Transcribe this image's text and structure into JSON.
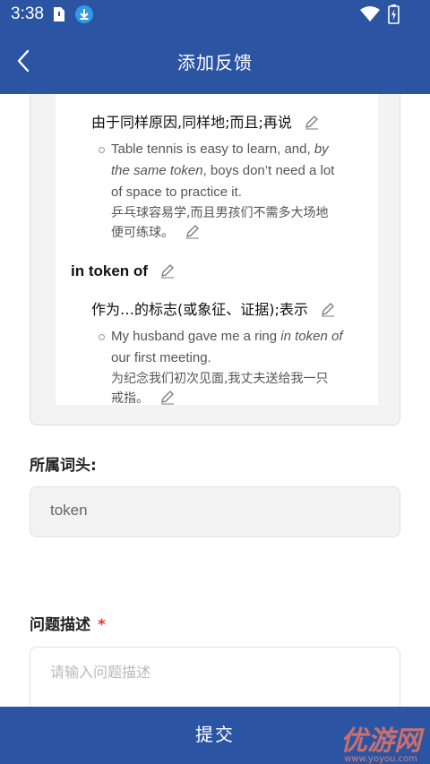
{
  "status_bar": {
    "time": "3:38"
  },
  "header": {
    "title": "添加反馈"
  },
  "preview": {
    "def1": "由于同样原因,同样地;而且;再说",
    "ex1_en_lines": [
      "Table tennis is easy to learn, and, ",
      "by",
      "the same token",
      ", boys don’t need a lot",
      "of space to practice it."
    ],
    "ex1_zh_lines": [
      "乒乓球容易学,而且男孩们不需多大场地",
      "便可练球。"
    ],
    "phrase": "in token of",
    "def2": "作为…的标志(或象征、证据);表示",
    "ex2_en_lines": [
      "My husband gave me a ring ",
      "in token of",
      "our first meeting."
    ],
    "ex2_zh_lines": [
      "为纪念我们初次见面,我丈夫送给我一只",
      "戒指。"
    ]
  },
  "form": {
    "headword_label": "所属词头:",
    "headword_value": "token",
    "description_label": "问题描述",
    "required_mark": "*",
    "description_placeholder": "请输入问题描述"
  },
  "submit_label": "提交",
  "watermark": {
    "text": "优游网",
    "url_text": "www.yoyou.com"
  },
  "colors": {
    "primary": "#2b54a3",
    "required": "#e23b3b"
  }
}
